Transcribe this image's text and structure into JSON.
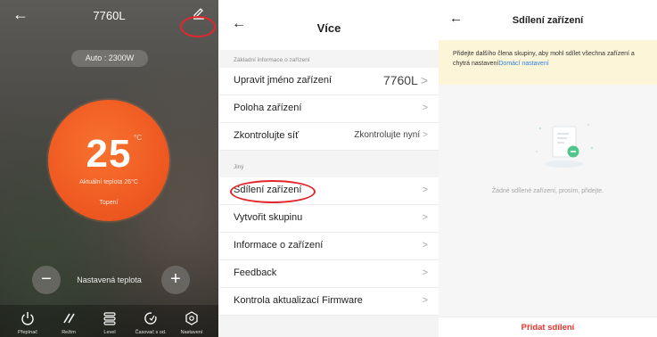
{
  "panel1": {
    "title": "7760L",
    "auto_power": "Auto : 2300W",
    "temperature": "25",
    "temperature_unit": "°C",
    "actual_temp_label": "Aktuální teplota 26°C",
    "mode_label": "Topení",
    "set_temp_label": "Nastavená teplota",
    "minus": "−",
    "plus": "+",
    "tabs": [
      {
        "label": "Přepínač",
        "icon": "power-icon"
      },
      {
        "label": "Režim",
        "icon": "mode-icon"
      },
      {
        "label": "Level",
        "icon": "level-icon"
      },
      {
        "label": "Časovač s od.",
        "icon": "timer-icon"
      },
      {
        "label": "Nastavení",
        "icon": "settings-icon"
      }
    ],
    "colors": {
      "dial": "#ef5a22",
      "highlight": "#e3262b"
    }
  },
  "panel2": {
    "title": "Více",
    "section_basic": "Základní informace o zařízení",
    "section_other": "Jiný",
    "rows_basic": [
      {
        "label": "Upravit jméno zařízení",
        "value": "7760L"
      },
      {
        "label": "Poloha zařízení",
        "value": ""
      },
      {
        "label": "Zkontrolujte síť",
        "value": "Zkontrolujte nyní"
      }
    ],
    "rows_other": [
      {
        "label": "Sdílení zařízení"
      },
      {
        "label": "Vytvořit skupinu"
      },
      {
        "label": "Informace o zařízení"
      },
      {
        "label": "Feedback"
      },
      {
        "label": "Kontrola aktualizací Firmware"
      }
    ],
    "chevron": ">"
  },
  "panel3": {
    "title": "Sdílení zařízení",
    "notice_text": "Přidejte dalšího člena skupiny, aby mohl sdílet všechna zařízení a chytrá nastavení",
    "notice_link": "Domácí nastavení",
    "empty_text": "Žádné sdílené zařízení, prosím, přidejte.",
    "add_button": "Přidat sdílení",
    "colors": {
      "link": "#2b7fe0",
      "button": "#e5352c",
      "notice_bg": "#fdf5d8"
    }
  }
}
